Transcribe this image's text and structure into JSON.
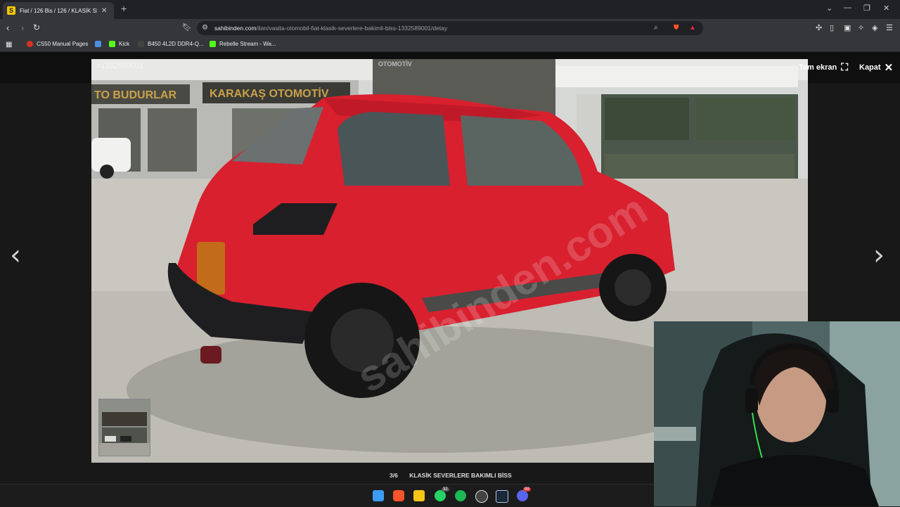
{
  "browser": {
    "tab": {
      "title": "Fiat / 126 Bis / 126 / KLASİK SEV",
      "close": "✕"
    },
    "new_tab": "+",
    "url_host": "sahibinden.com",
    "url_path": "/ilan/vasita-otomobil-fiat-klasik-severlere-bakimli-biss-1332589001/detay",
    "bookmarks": [
      {
        "label": "CS50 Manual Pages",
        "color": "#d93025"
      },
      {
        "label": "",
        "color": "#4a90e2"
      },
      {
        "label": "Kick",
        "color": "#53fc18"
      },
      {
        "label": "B450 4L2D DDR4-Q...",
        "color": "#333333"
      },
      {
        "label": "Rebelle Stream - Wa...",
        "color": "#53fc18"
      }
    ]
  },
  "viewer": {
    "ad_id": "#1332589001",
    "fullscreen_label": "Tam ekran",
    "close_label": "Kapat",
    "counter": "3/6",
    "caption": "KLASİK SEVERLERE BAKIMLI BİSS",
    "prev_arrow": "‹",
    "next_arrow": "›"
  },
  "photo": {
    "signs": [
      "TO BUDURLAR",
      "KARAKAŞ OTOMOTİV",
      "OTOMOTİV"
    ],
    "watermark": "sahibinden.com",
    "car_color": "#d8202f"
  },
  "taskbar": {
    "icons": [
      {
        "name": "windows-start-icon",
        "color": "#3b9cf5"
      },
      {
        "name": "brave-icon",
        "color": "#fb542b"
      },
      {
        "name": "file-explorer-icon",
        "color": "#f5c518"
      },
      {
        "name": "whatsapp-icon",
        "color": "#25d366",
        "badge": "32"
      },
      {
        "name": "spotify-icon",
        "color": "#1db954"
      },
      {
        "name": "chrome-icon",
        "color": "#dddddd"
      },
      {
        "name": "steam-icon",
        "color": "#a6c8e8"
      },
      {
        "name": "discord-icon",
        "color": "#5865f2",
        "badge": "99"
      }
    ]
  }
}
